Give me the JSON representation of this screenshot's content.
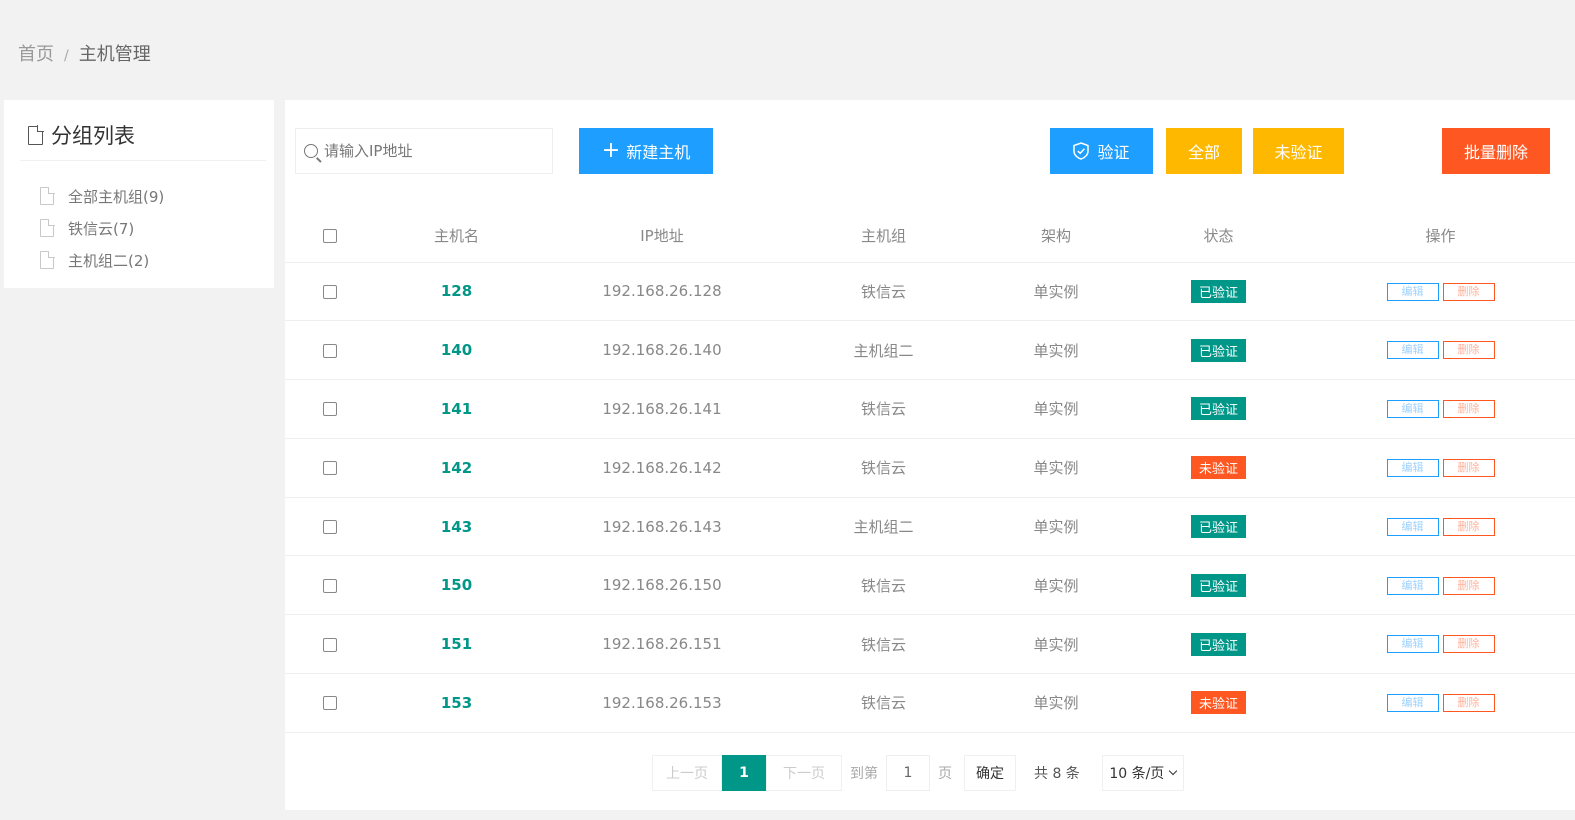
{
  "breadcrumb": {
    "home": "首页",
    "separator": "/",
    "current": "主机管理"
  },
  "sidebar": {
    "title": "分组列表",
    "groups": [
      {
        "label": "全部主机组(9)"
      },
      {
        "label": "铁信云(7)"
      },
      {
        "label": "主机组二(2)"
      }
    ]
  },
  "toolbar": {
    "search_placeholder": "请输入IP地址",
    "new_host": "新建主机",
    "verify": "验证",
    "all": "全部",
    "unverified": "未验证",
    "batch_delete": "批量删除"
  },
  "table": {
    "headers": [
      "主机名",
      "IP地址",
      "主机组",
      "架构",
      "状态",
      "操作"
    ],
    "actions": {
      "edit": "编辑",
      "delete": "删除"
    },
    "rows": [
      {
        "name": "128",
        "ip": "192.168.26.128",
        "group": "铁信云",
        "arch": "单实例",
        "status": "已验证",
        "verified": true
      },
      {
        "name": "140",
        "ip": "192.168.26.140",
        "group": "主机组二",
        "arch": "单实例",
        "status": "已验证",
        "verified": true
      },
      {
        "name": "141",
        "ip": "192.168.26.141",
        "group": "铁信云",
        "arch": "单实例",
        "status": "已验证",
        "verified": true
      },
      {
        "name": "142",
        "ip": "192.168.26.142",
        "group": "铁信云",
        "arch": "单实例",
        "status": "未验证",
        "verified": false
      },
      {
        "name": "143",
        "ip": "192.168.26.143",
        "group": "主机组二",
        "arch": "单实例",
        "status": "已验证",
        "verified": true
      },
      {
        "name": "150",
        "ip": "192.168.26.150",
        "group": "铁信云",
        "arch": "单实例",
        "status": "已验证",
        "verified": true
      },
      {
        "name": "151",
        "ip": "192.168.26.151",
        "group": "铁信云",
        "arch": "单实例",
        "status": "已验证",
        "verified": true
      },
      {
        "name": "153",
        "ip": "192.168.26.153",
        "group": "铁信云",
        "arch": "单实例",
        "status": "未验证",
        "verified": false
      }
    ]
  },
  "pagination": {
    "prev": "上一页",
    "current": "1",
    "next": "下一页",
    "goto": "到第",
    "page_input": "1",
    "page_unit": "页",
    "confirm": "确定",
    "total": "共 8 条",
    "page_size": "10 条/页"
  },
  "colors": {
    "blue": "#1e9fff",
    "yellow": "#ffb800",
    "orange": "#ff5722",
    "teal": "#009688"
  }
}
